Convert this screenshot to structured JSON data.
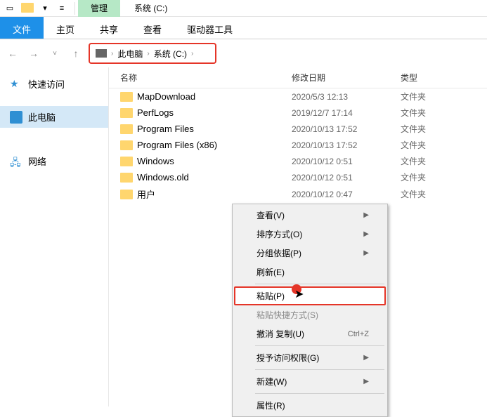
{
  "titlebar": {
    "tab_manage": "管理",
    "title": "系统 (C:)"
  },
  "ribbon": {
    "file": "文件",
    "home": "主页",
    "share": "共享",
    "view": "查看",
    "tools": "驱动器工具"
  },
  "nav": {
    "breadcrumb": {
      "this_pc": "此电脑",
      "drive": "系统 (C:)"
    }
  },
  "sidebar": {
    "quick_access": "快速访问",
    "this_pc": "此电脑",
    "network": "网络"
  },
  "columns": {
    "name": "名称",
    "date": "修改日期",
    "type": "类型"
  },
  "files": [
    {
      "name": "MapDownload",
      "date": "2020/5/3 12:13",
      "type": "文件夹"
    },
    {
      "name": "PerfLogs",
      "date": "2019/12/7 17:14",
      "type": "文件夹"
    },
    {
      "name": "Program Files",
      "date": "2020/10/13 17:52",
      "type": "文件夹"
    },
    {
      "name": "Program Files (x86)",
      "date": "2020/10/13 17:52",
      "type": "文件夹"
    },
    {
      "name": "Windows",
      "date": "2020/10/12 0:51",
      "type": "文件夹"
    },
    {
      "name": "Windows.old",
      "date": "2020/10/12 0:51",
      "type": "文件夹"
    },
    {
      "name": "用户",
      "date": "2020/10/12 0:47",
      "type": "文件夹"
    }
  ],
  "context_menu": {
    "view": "查看(V)",
    "sort": "排序方式(O)",
    "group": "分组依据(P)",
    "refresh": "刷新(E)",
    "paste": "粘贴(P)",
    "paste_shortcut": "粘贴快捷方式(S)",
    "undo": "撤消 复制(U)",
    "undo_key": "Ctrl+Z",
    "grant_access": "授予访问权限(G)",
    "new": "新建(W)",
    "properties": "属性(R)"
  }
}
